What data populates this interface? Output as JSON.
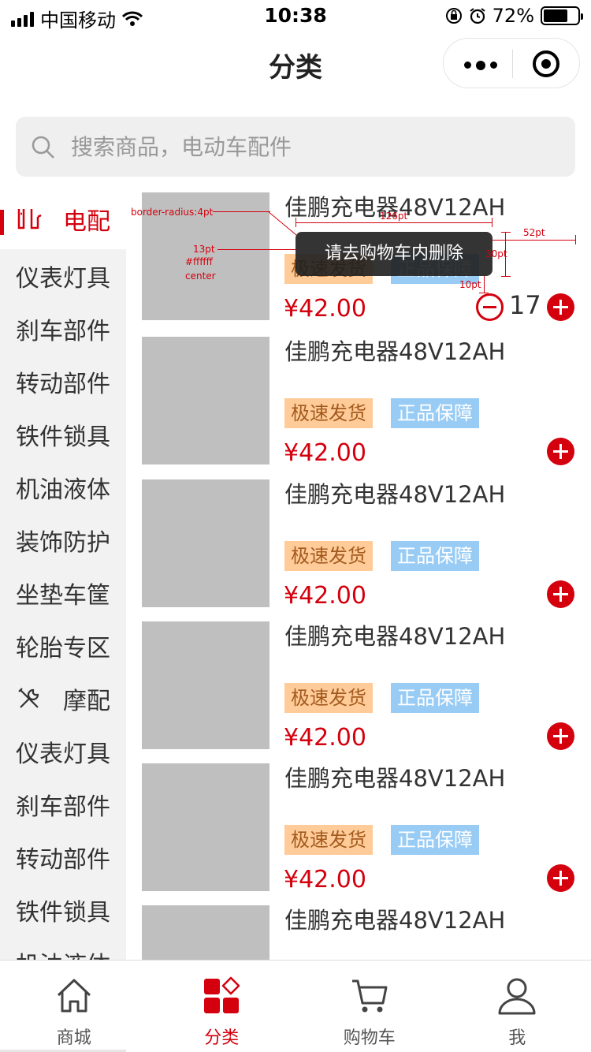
{
  "status": {
    "carrier": "中国移动",
    "time": "10:38",
    "battery": "72%"
  },
  "nav": {
    "title": "分类"
  },
  "search": {
    "placeholder": "搜索商品，电动车配件"
  },
  "sidebar": {
    "items": [
      {
        "label": "电配"
      },
      {
        "label": "仪表灯具"
      },
      {
        "label": "刹车部件"
      },
      {
        "label": "转动部件"
      },
      {
        "label": "铁件锁具"
      },
      {
        "label": "机油液体"
      },
      {
        "label": "装饰防护"
      },
      {
        "label": "坐垫车筐"
      },
      {
        "label": "轮胎专区"
      },
      {
        "label": "摩配"
      },
      {
        "label": "仪表灯具"
      },
      {
        "label": "刹车部件"
      },
      {
        "label": "转动部件"
      },
      {
        "label": "铁件锁具"
      },
      {
        "label": "机油液体"
      }
    ]
  },
  "products": [
    {
      "name": "佳鹏充电器48V12AH",
      "tag1": "极速发货",
      "tag2": "正品保障",
      "price": "¥42.00",
      "qty": "17"
    },
    {
      "name": "佳鹏充电器48V12AH",
      "tag1": "极速发货",
      "tag2": "正品保障",
      "price": "¥42.00"
    },
    {
      "name": "佳鹏充电器48V12AH",
      "tag1": "极速发货",
      "tag2": "正品保障",
      "price": "¥42.00"
    },
    {
      "name": "佳鹏充电器48V12AH",
      "tag1": "极速发货",
      "tag2": "正品保障",
      "price": "¥42.00"
    },
    {
      "name": "佳鹏充电器48V12AH",
      "tag1": "极速发货",
      "tag2": "正品保障",
      "price": "¥42.00"
    },
    {
      "name": "佳鹏充电器48V12AH"
    }
  ],
  "toast": {
    "text": "请去购物车内删除"
  },
  "annotations": {
    "radius": "border-radius:4pt",
    "font": "13pt",
    "color": "#ffffff",
    "align": "center",
    "width": "126pt",
    "offset": "52pt",
    "height": "30pt",
    "gap": "10pt"
  },
  "tabbar": {
    "items": [
      {
        "label": "商城"
      },
      {
        "label": "分类"
      },
      {
        "label": "购物车"
      },
      {
        "label": "我"
      }
    ]
  },
  "colors": {
    "accent": "#d4000d",
    "tag_fast_bg": "#ffcc99",
    "tag_genuine_bg": "#99ccf5"
  }
}
